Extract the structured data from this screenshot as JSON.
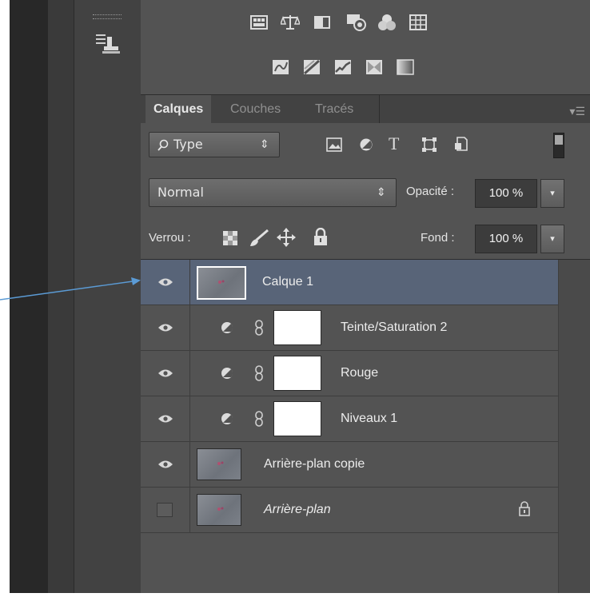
{
  "tabs": [
    {
      "label": "Calques",
      "active": true
    },
    {
      "label": "Couches",
      "active": false
    },
    {
      "label": "Tracés",
      "active": false
    }
  ],
  "filter": {
    "label": "Type",
    "icon": "search-icon"
  },
  "blend_mode": {
    "value": "Normal"
  },
  "opacity": {
    "label": "Opacité :",
    "value": "100 %"
  },
  "lock": {
    "label": "Verrou :"
  },
  "fill": {
    "label": "Fond :",
    "value": "100 %"
  },
  "layers": [
    {
      "name": "Calque 1",
      "selected": true,
      "visible": true,
      "type": "pixel"
    },
    {
      "name": "Teinte/Saturation 2",
      "selected": false,
      "visible": true,
      "type": "adjustment"
    },
    {
      "name": "Rouge",
      "selected": false,
      "visible": true,
      "type": "adjustment"
    },
    {
      "name": "Niveaux 1",
      "selected": false,
      "visible": true,
      "type": "adjustment"
    },
    {
      "name": "Arrière-plan copie",
      "selected": false,
      "visible": true,
      "type": "pixel"
    },
    {
      "name": "Arrière-plan",
      "selected": false,
      "visible": false,
      "type": "background",
      "locked": true
    }
  ],
  "colors": {
    "panel": "#535353",
    "selected_row": "#586478",
    "annotation_arrow": "#5b9bd5"
  }
}
